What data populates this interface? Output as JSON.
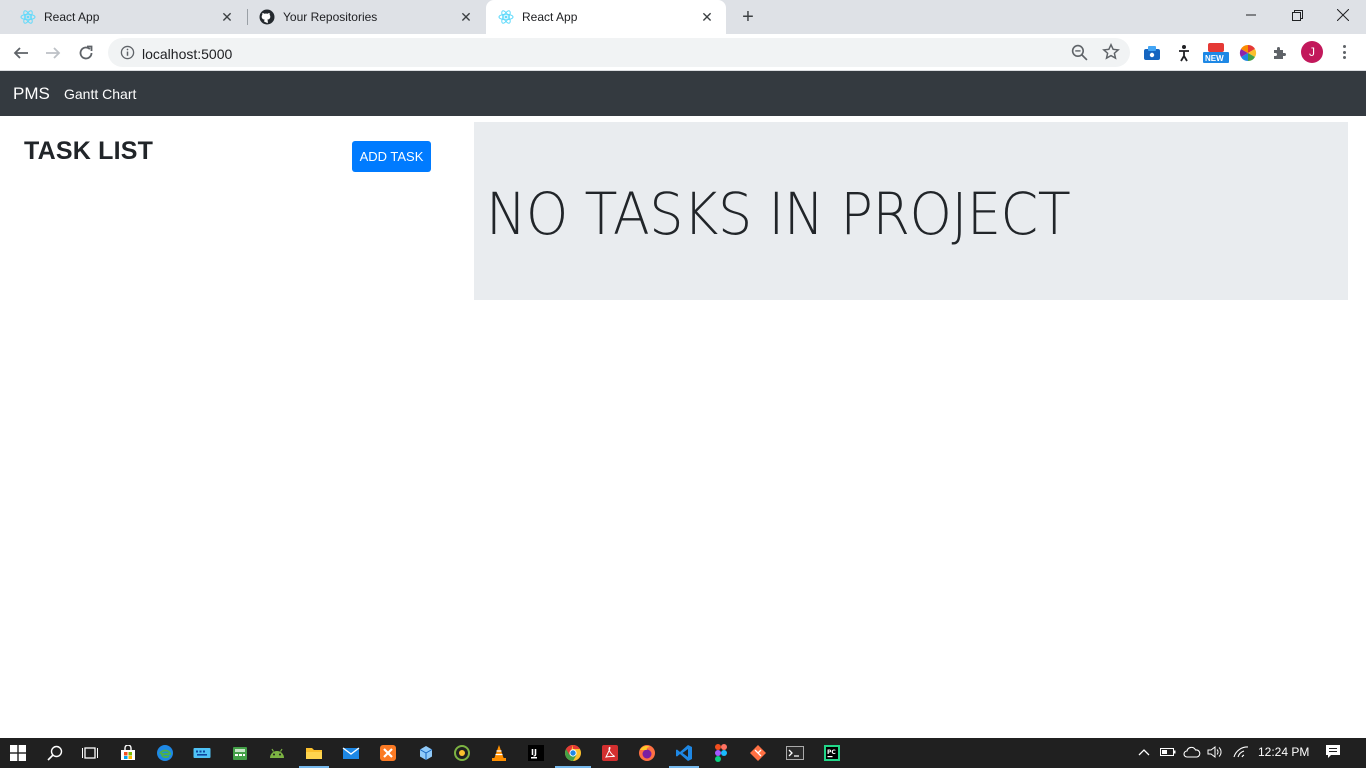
{
  "browser": {
    "tabs": [
      {
        "title": "React App",
        "icon": "react-icon",
        "active": false
      },
      {
        "title": "Your Repositories",
        "icon": "github-icon",
        "active": false
      },
      {
        "title": "React App",
        "icon": "react-icon",
        "active": true
      }
    ],
    "url": "localhost:5000",
    "profile_initial": "J",
    "ext_badge": "NEW"
  },
  "navbar": {
    "brand": "PMS",
    "links": [
      "Gantt Chart"
    ]
  },
  "main": {
    "title": "TASK LIST",
    "add_button": "ADD TASK",
    "empty_message": "NO TASKS IN PROJECT"
  },
  "taskbar": {
    "time": "12:24 PM"
  },
  "colors": {
    "navbar_bg": "#343a40",
    "primary": "#007bff",
    "jumbotron_bg": "#e9ecef"
  }
}
